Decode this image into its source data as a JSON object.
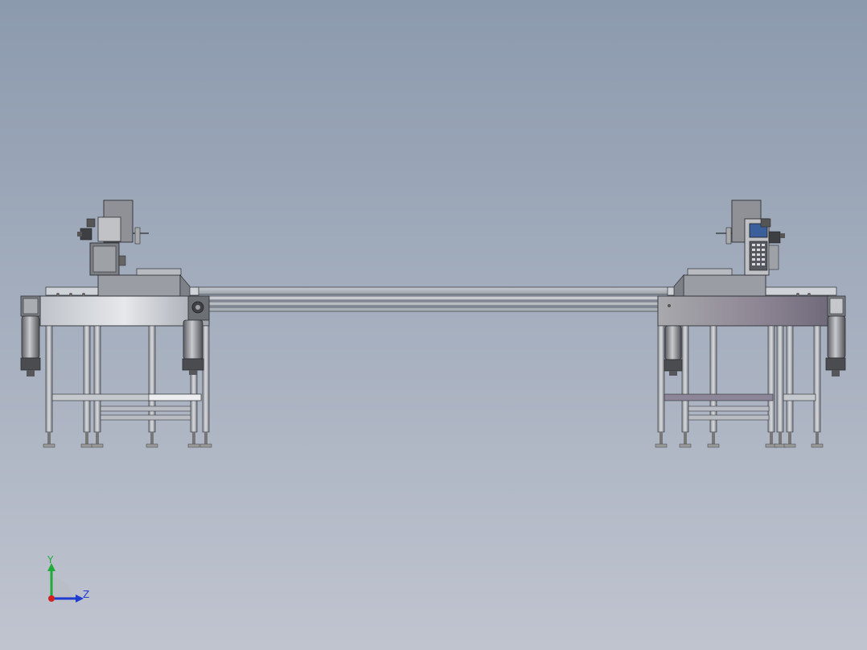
{
  "triad": {
    "y_label": "Y",
    "z_label": "Z"
  },
  "colors": {
    "background_top": "#8c9aae",
    "background_bottom": "#c0c4cf",
    "triad_y": "#1faa3a",
    "triad_z": "#1f3ccf",
    "triad_origin": "#d02020",
    "panel_screen": "#3a5f9a"
  }
}
